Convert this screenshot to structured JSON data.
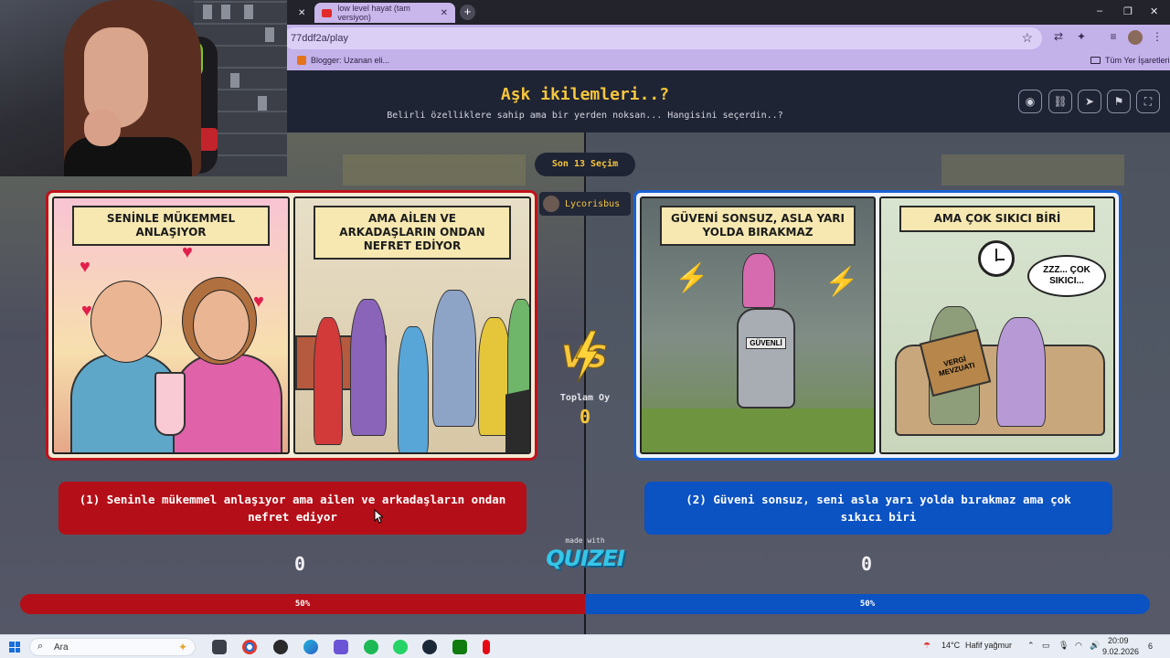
{
  "browser": {
    "tabs": [
      {
        "label": "low level hayat (tam versiyon)",
        "active": true
      }
    ],
    "new_tab": "+",
    "url": "77ddf2a/play",
    "bookmarks": [
      {
        "label": "Blogger: Uzanan eli..."
      },
      {
        "label": "Tüm Yer İşaretleri"
      }
    ],
    "window_controls": {
      "minimize": "–",
      "restore": "❐",
      "close": "✕"
    }
  },
  "header": {
    "title": "Aşk ikilemleri..?",
    "subtitle": "Belirli özelliklere sahip ama bir yerden noksan... Hangisini seçerdin..?",
    "buttons": [
      {
        "name": "eye-button",
        "icon": "eye-icon",
        "glyph": "◉"
      },
      {
        "name": "link-button",
        "icon": "link-icon",
        "glyph": "⛓"
      },
      {
        "name": "share-button",
        "icon": "send-icon",
        "glyph": "➤"
      },
      {
        "name": "report-button",
        "icon": "flag-icon",
        "glyph": "⚑"
      },
      {
        "name": "fullscreen-button",
        "icon": "fullscreen-icon",
        "glyph": "⛶"
      }
    ]
  },
  "round": {
    "badge": "Son 13 Seçim",
    "user": "Lycorisbus"
  },
  "left_option": {
    "panels": [
      {
        "banner": "SENİNLE MÜKEMMEL ANLAŞIYOR"
      },
      {
        "banner": "AMA AİLEN VE ARKADAŞLARIN ONDAN NEFRET EDİYOR"
      }
    ],
    "label": "(1) Seninle mükemmel anlaşıyor ama ailen ve arkadaşların ondan nefret ediyor",
    "votes": "0",
    "percent_label": "50%",
    "percent": 50,
    "color": "#b40f18"
  },
  "right_option": {
    "panels": [
      {
        "banner": "GÜVENİ SONSUZ, ASLA YARI YOLDA BIRAKMAZ",
        "armor_text": "GÜVENLİ"
      },
      {
        "banner": "AMA ÇOK SIKICI BİRİ",
        "bubble": "ZZZ... ÇOK SIKICI...",
        "book_text": "VERGİ MEVZUATI"
      }
    ],
    "label": "(2) Güveni sonsuz, seni asla yarı yolda bırakmaz ama çok sıkıcı biri",
    "votes": "0",
    "percent_label": "50%",
    "percent": 50,
    "color": "#0b52c2"
  },
  "center": {
    "vs": "VS",
    "total_label": "Toplam Oy",
    "total_value": "0",
    "made_with": "made with",
    "brand": "QUIZEI"
  },
  "taskbar": {
    "search_label": "Ara",
    "weather": "14°C",
    "weather_desc": "Hafif yağmur",
    "time": "20:09",
    "date": "9.02.2026",
    "notifications": "6"
  }
}
